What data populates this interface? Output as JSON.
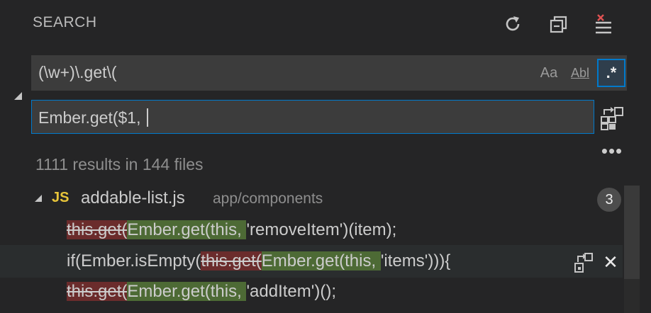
{
  "header": {
    "title": "SEARCH",
    "actions": [
      {
        "name": "refresh",
        "icon": "refresh-icon"
      },
      {
        "name": "collapse-all",
        "icon": "collapse-all-icon"
      },
      {
        "name": "clear-results",
        "icon": "clear-results-icon"
      }
    ]
  },
  "search": {
    "value": "(\\w+)\\.get\\(",
    "match_case_label": "Aa",
    "whole_word_label": "Abl",
    "regex_label": ".*",
    "regex_enabled": true
  },
  "replace": {
    "value": "Ember.get($1, "
  },
  "more_label": "•••",
  "summary": "1111 results in 144 files",
  "file": {
    "icon_label": "JS",
    "name": "addable-list.js",
    "path": "app/components",
    "count": "3"
  },
  "matches": [
    {
      "before": "",
      "deleted": "this.get(",
      "inserted": "Ember.get(this, ",
      "after": "'removeItem')(item);"
    },
    {
      "before": "if(Ember.isEmpty(",
      "deleted": "this.get(",
      "inserted": "Ember.get(this, ",
      "after": "'items'))){"
    },
    {
      "before": "",
      "deleted": "this.get(",
      "inserted": "Ember.get(this, ",
      "after": "'addItem')();"
    }
  ],
  "colors": {
    "background": "#252526",
    "input": "#3c3c3c",
    "accent": "#007acc",
    "deleted": "#6b2c2c",
    "inserted": "#4d6a35",
    "js": "#e8c53a"
  }
}
